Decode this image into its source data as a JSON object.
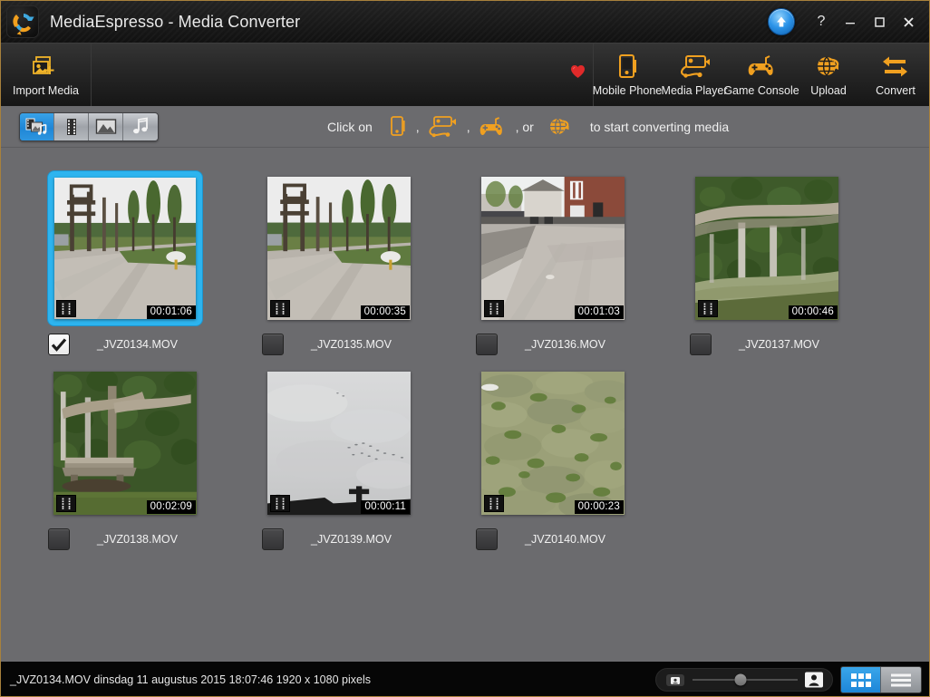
{
  "window": {
    "title": "MediaEspresso - Media Converter",
    "accent_blue": "#2db4ef",
    "accent_orange": "#f5a623",
    "border_color": "#a8813c"
  },
  "titlebar": {
    "logo_icon": "media-espresso-logo-icon",
    "upload_button_icon": "blue-up-arrow-icon",
    "help_label": "?",
    "minimize_label": "─",
    "maximize_label": "☐",
    "close_label": "✕"
  },
  "toolbar": {
    "import": {
      "label": "Import Media",
      "icon": "import-media-icon"
    },
    "favorite_icon": "red-heart-icon",
    "actions": [
      {
        "label": "Mobile Phone",
        "icon": "mobile-phone-icon"
      },
      {
        "label": "Media Player",
        "icon": "media-player-icon"
      },
      {
        "label": "Game Console",
        "icon": "game-console-icon"
      },
      {
        "label": "Upload",
        "icon": "globe-upload-icon"
      },
      {
        "label": "Convert",
        "icon": "convert-arrows-icon"
      }
    ]
  },
  "filterbar": {
    "tabs": [
      {
        "name": "all-media",
        "icon": "all-media-icon",
        "active": true
      },
      {
        "name": "video",
        "icon": "film-strip-icon",
        "active": false
      },
      {
        "name": "photo",
        "icon": "photo-icon",
        "active": false
      },
      {
        "name": "music",
        "icon": "music-note-icon",
        "active": false
      }
    ],
    "hint": {
      "prefix": "Click on",
      "sep1": ",",
      "sep2": ",",
      "sep3": ", or",
      "suffix": "to start converting media",
      "icons": [
        "mobile-phone-icon",
        "media-player-icon",
        "game-console-icon",
        "globe-upload-icon"
      ]
    }
  },
  "media": {
    "items": [
      {
        "filename": "_JVZ0134.MOV",
        "duration": "00:01:06",
        "selected": true,
        "checked": true,
        "scene": "path-trees"
      },
      {
        "filename": "_JVZ0135.MOV",
        "duration": "00:00:35",
        "selected": false,
        "checked": false,
        "scene": "path-trees"
      },
      {
        "filename": "_JVZ0136.MOV",
        "duration": "00:01:03",
        "selected": false,
        "checked": false,
        "scene": "street-houses"
      },
      {
        "filename": "_JVZ0137.MOV",
        "duration": "00:00:46",
        "selected": false,
        "checked": false,
        "scene": "hedge-fence"
      },
      {
        "filename": "_JVZ0138.MOV",
        "duration": "00:02:09",
        "selected": false,
        "checked": false,
        "scene": "bench-hedge"
      },
      {
        "filename": "_JVZ0139.MOV",
        "duration": "00:00:11",
        "selected": false,
        "checked": false,
        "scene": "grey-sky"
      },
      {
        "filename": "_JVZ0140.MOV",
        "duration": "00:00:23",
        "selected": false,
        "checked": false,
        "scene": "grass-field"
      }
    ]
  },
  "statusbar": {
    "text": "_JVZ0134.MOV  dinsdag 11 augustus 2015 18:07:46  1920 x 1080 pixels",
    "slider": {
      "small_icon": "small-thumbnail-icon",
      "large_icon": "large-thumbnail-icon",
      "value_percent": 46
    },
    "views": [
      {
        "name": "grid-view",
        "icon": "grid-view-icon",
        "active": true
      },
      {
        "name": "list-view",
        "icon": "list-view-icon",
        "active": false
      }
    ]
  }
}
